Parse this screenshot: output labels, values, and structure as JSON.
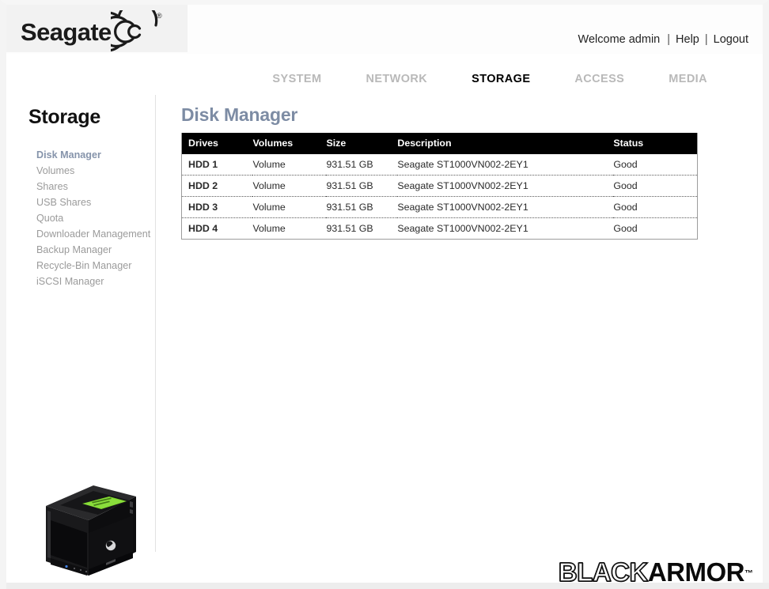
{
  "brand": {
    "name": "Seagate",
    "registered_mark": "®",
    "logo_icon": "seagate-spiral-icon"
  },
  "account_bar": {
    "welcome": "Welcome admin",
    "separator": "|",
    "help": "Help",
    "logout": "Logout"
  },
  "topnav": {
    "items": [
      {
        "label": "SYSTEM",
        "active": false
      },
      {
        "label": "NETWORK",
        "active": false
      },
      {
        "label": "STORAGE",
        "active": true
      },
      {
        "label": "ACCESS",
        "active": false
      },
      {
        "label": "MEDIA",
        "active": false
      }
    ]
  },
  "sidebar": {
    "title": "Storage",
    "items": [
      {
        "label": "Disk Manager",
        "active": true
      },
      {
        "label": "Volumes",
        "active": false
      },
      {
        "label": "Shares",
        "active": false
      },
      {
        "label": "USB Shares",
        "active": false
      },
      {
        "label": "Quota",
        "active": false
      },
      {
        "label": "Downloader Management",
        "active": false
      },
      {
        "label": "Backup Manager",
        "active": false
      },
      {
        "label": "Recycle-Bin Manager",
        "active": false
      },
      {
        "label": "iSCSI Manager",
        "active": false
      }
    ],
    "device_image": "blackarmor-nas-device-icon",
    "device_lcd_line1": "Seagate NAS",
    "device_lcd_line2": "Disk Manager"
  },
  "main": {
    "page_title": "Disk Manager",
    "table": {
      "columns": [
        "Drives",
        "Volumes",
        "Size",
        "Description",
        "Status"
      ],
      "rows": [
        {
          "drive": "HDD 1",
          "volume": "Volume",
          "size": "931.51 GB",
          "description": "Seagate ST1000VN002-2EY1",
          "status": "Good"
        },
        {
          "drive": "HDD 2",
          "volume": "Volume",
          "size": "931.51 GB",
          "description": "Seagate ST1000VN002-2EY1",
          "status": "Good"
        },
        {
          "drive": "HDD 3",
          "volume": "Volume",
          "size": "931.51 GB",
          "description": "Seagate ST1000VN002-2EY1",
          "status": "Good"
        },
        {
          "drive": "HDD 4",
          "volume": "Volume",
          "size": "931.51 GB",
          "description": "Seagate ST1000VN002-2EY1",
          "status": "Good"
        }
      ]
    }
  },
  "footer": {
    "logo_part1": "BLACK",
    "logo_part2": "ARMOR",
    "trademark": "™"
  },
  "colors": {
    "nav_active": "#000000",
    "nav_inactive": "#b9b9b9",
    "title_blue_gray": "#7d8ca4",
    "sidebar_active": "#8694ab",
    "sidebar_inactive": "#9b9b9b",
    "table_header_bg": "#000000",
    "lcd_green": "#7dd62b"
  }
}
